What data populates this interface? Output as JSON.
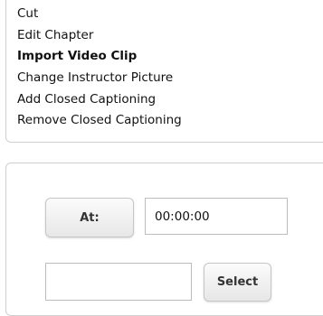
{
  "menu": {
    "items": [
      {
        "label": "Cut"
      },
      {
        "label": "Edit Chapter"
      },
      {
        "label": "Import Video Clip"
      },
      {
        "label": "Change Instructor Picture"
      },
      {
        "label": "Add Closed Captioning"
      },
      {
        "label": "Remove Closed Captioning"
      }
    ],
    "active": "Import Video Clip"
  },
  "form": {
    "at_label": "At:",
    "time_value": "00:00:00",
    "file_value": "",
    "select_label": "Select"
  }
}
